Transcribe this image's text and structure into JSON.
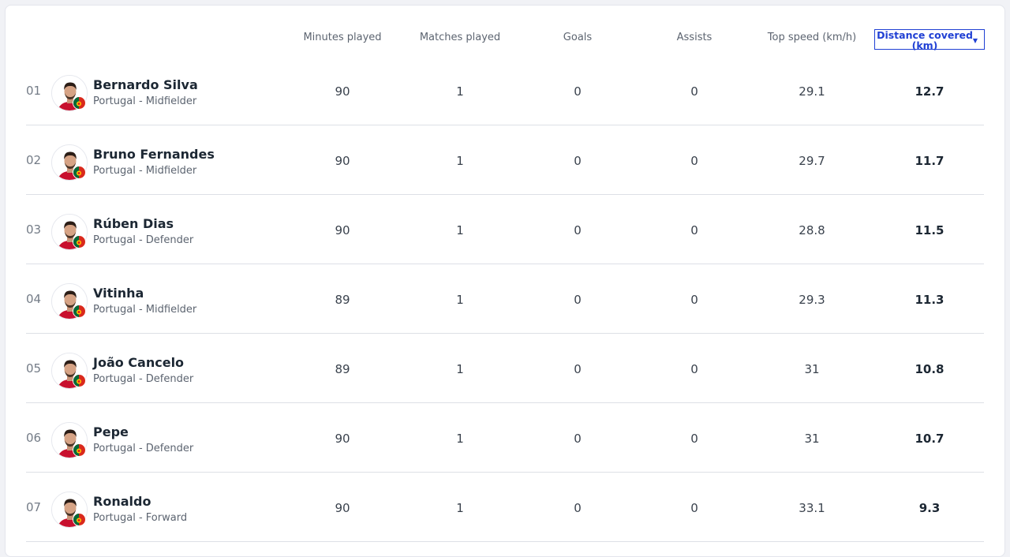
{
  "columns": [
    {
      "label": "Minutes played"
    },
    {
      "label": "Matches played"
    },
    {
      "label": "Goals"
    },
    {
      "label": "Assists"
    },
    {
      "label": "Top speed (km/h)"
    },
    {
      "label": "Distance covered (km)",
      "sorted": true,
      "sort_icon": "caret-down-icon"
    }
  ],
  "colors": {
    "accent": "#2040d4",
    "divider": "#dde0e6",
    "flag_green": "#046a38",
    "flag_red": "#da291c"
  },
  "players": [
    {
      "rank": "01",
      "name": "Bernardo Silva",
      "meta": "Portugal - Midfielder",
      "minutes": "90",
      "matches": "1",
      "goals": "0",
      "assists": "0",
      "top_speed": "29.1",
      "distance": "12.7"
    },
    {
      "rank": "02",
      "name": "Bruno Fernandes",
      "meta": "Portugal - Midfielder",
      "minutes": "90",
      "matches": "1",
      "goals": "0",
      "assists": "0",
      "top_speed": "29.7",
      "distance": "11.7"
    },
    {
      "rank": "03",
      "name": "Rúben Dias",
      "meta": "Portugal - Defender",
      "minutes": "90",
      "matches": "1",
      "goals": "0",
      "assists": "0",
      "top_speed": "28.8",
      "distance": "11.5"
    },
    {
      "rank": "04",
      "name": "Vitinha",
      "meta": "Portugal - Midfielder",
      "minutes": "89",
      "matches": "1",
      "goals": "0",
      "assists": "0",
      "top_speed": "29.3",
      "distance": "11.3"
    },
    {
      "rank": "05",
      "name": "João Cancelo",
      "meta": "Portugal - Defender",
      "minutes": "89",
      "matches": "1",
      "goals": "0",
      "assists": "0",
      "top_speed": "31",
      "distance": "10.8"
    },
    {
      "rank": "06",
      "name": "Pepe",
      "meta": "Portugal - Defender",
      "minutes": "90",
      "matches": "1",
      "goals": "0",
      "assists": "0",
      "top_speed": "31",
      "distance": "10.7"
    },
    {
      "rank": "07",
      "name": "Ronaldo",
      "meta": "Portugal - Forward",
      "minutes": "90",
      "matches": "1",
      "goals": "0",
      "assists": "0",
      "top_speed": "33.1",
      "distance": "9.3"
    }
  ]
}
